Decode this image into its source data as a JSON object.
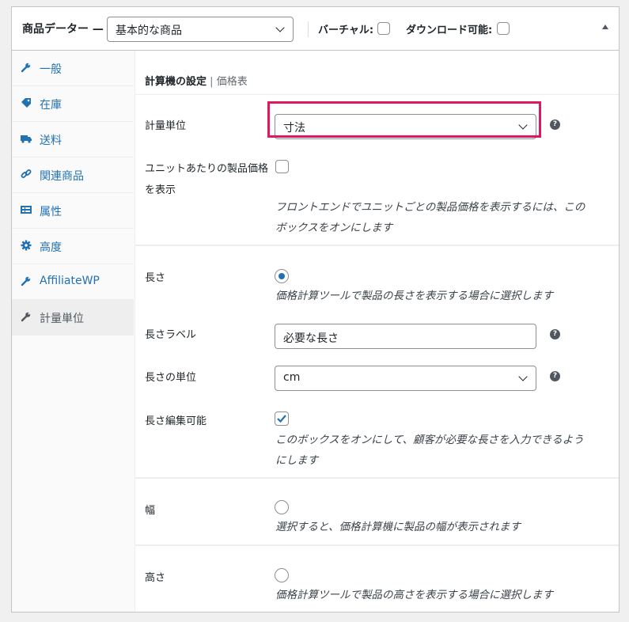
{
  "header": {
    "title": "商品データー —",
    "product_type": "基本的な商品",
    "virtual_label": "バーチャル:",
    "download_label": "ダウンロード可能:"
  },
  "sidebar": {
    "items": [
      {
        "label": "一般",
        "icon": "wrench-icon"
      },
      {
        "label": "在庫",
        "icon": "tag-icon"
      },
      {
        "label": "送料",
        "icon": "truck-icon"
      },
      {
        "label": "関連商品",
        "icon": "link-icon"
      },
      {
        "label": "属性",
        "icon": "list-icon"
      },
      {
        "label": "高度",
        "icon": "gear-icon"
      },
      {
        "label": "AffiliateWP",
        "icon": "wrench-icon"
      },
      {
        "label": "計量単位",
        "icon": "wrench-icon"
      }
    ]
  },
  "tabs": {
    "active": "計算機の設定",
    "separator": "|",
    "other": "価格表"
  },
  "unit": {
    "label": "計量単位",
    "value": "寸法"
  },
  "show_price": {
    "label_line1": "ユニットあたりの製品価格",
    "label_line2": "を表示",
    "desc_line1": "フロントエンドでユニットごとの製品価格を表示するには、この",
    "desc_line2": "ボックスをオンにします"
  },
  "length": {
    "label": "長さ",
    "desc": "価格計算ツールで製品の長さを表示する場合に選択します",
    "label_label": "長さラベル",
    "label_value": "必要な長さ",
    "unit_label": "長さの単位",
    "unit_value": "cm",
    "editable_label": "長さ編集可能",
    "editable_desc_line1": "このボックスをオンにして、顧客が必要な長さを入力できるよう",
    "editable_desc_line2": "にします"
  },
  "width": {
    "label": "幅",
    "desc": "選択すると、価格計算機に製品の幅が表示されます"
  },
  "height": {
    "label": "高さ",
    "desc": "価格計算ツールで製品の高さを表示する場合に選択します"
  },
  "help_glyph": "?",
  "colors": {
    "accent": "#2271b1",
    "highlight": "#e0185f"
  }
}
